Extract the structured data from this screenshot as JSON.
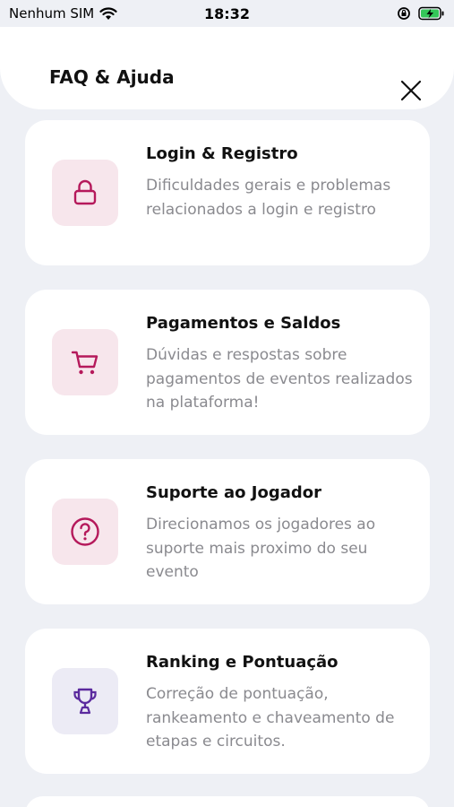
{
  "status_bar": {
    "carrier": "Nenhum SIM",
    "time": "18:32"
  },
  "header": {
    "title": "FAQ & Ajuda"
  },
  "colors": {
    "accent": "#b5195b",
    "accent_bg": "#f7e6ec",
    "purple": "#5b2a9e",
    "purple_bg": "#ecebf5",
    "battery": "#34c759"
  },
  "cards": [
    {
      "title": "Login & Registro",
      "description": "Dificuldades gerais e problemas relacionados a login e registro",
      "icon": "lock-icon"
    },
    {
      "title": "Pagamentos e Saldos",
      "description": "Dúvidas e respostas sobre pagamentos de eventos realizados na plataforma!",
      "icon": "cart-icon"
    },
    {
      "title": "Suporte ao Jogador",
      "description": "Direcionamos os jogadores ao suporte mais proximo do seu evento",
      "icon": "help-circle-icon"
    },
    {
      "title": "Ranking e Pontuação",
      "description": "Correção de pontuação, rankeamento e chaveamento de etapas e circuitos.",
      "icon": "trophy-icon"
    }
  ]
}
